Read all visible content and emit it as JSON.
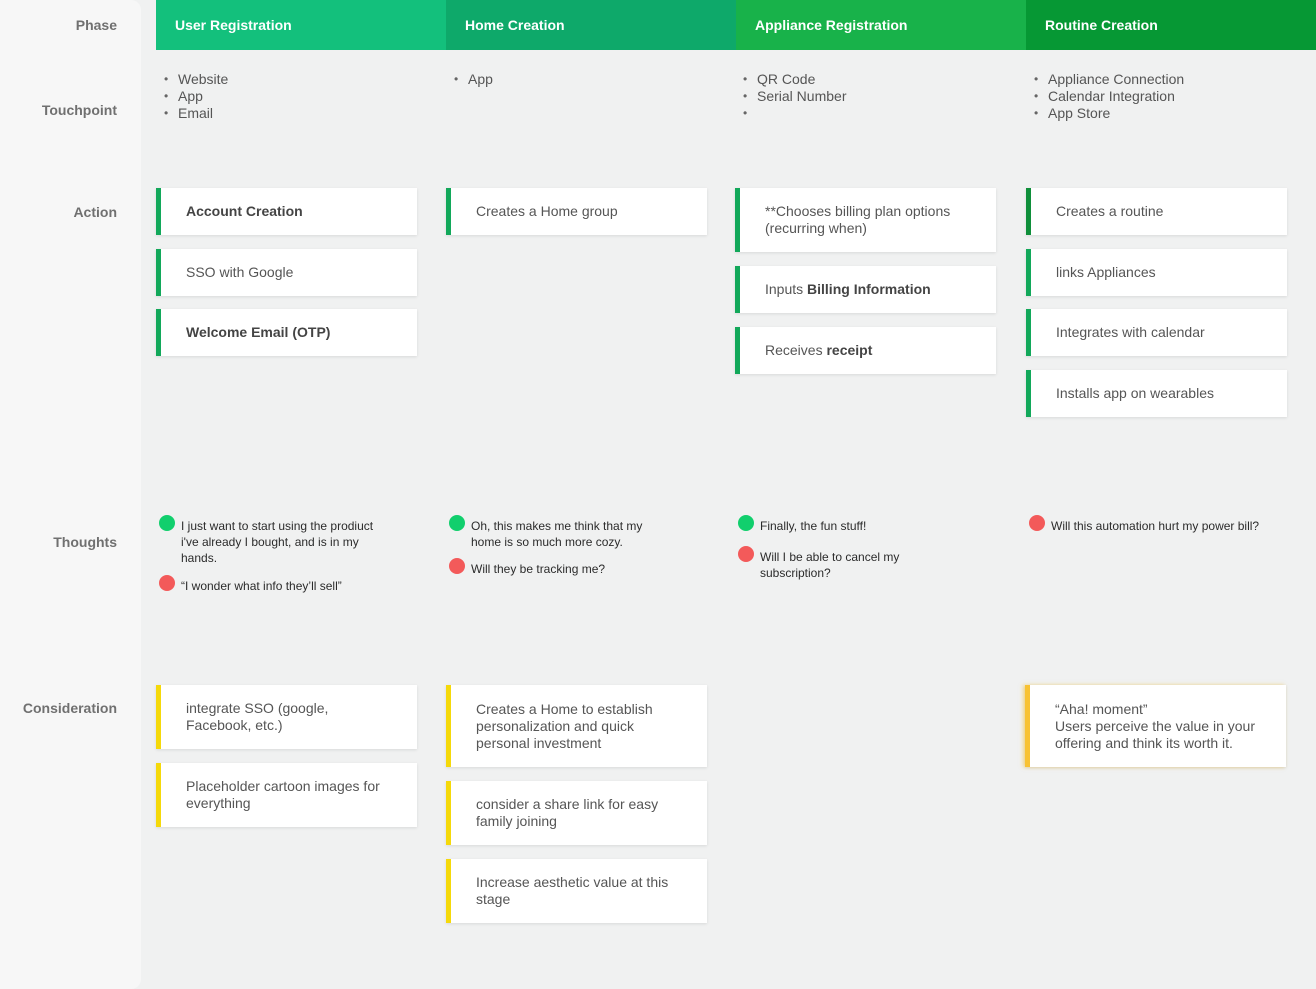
{
  "row_labels": {
    "phase": "Phase",
    "touchpoint": "Touchpoint",
    "action": "Action",
    "thoughts": "Thoughts",
    "consideration": "Consideration"
  },
  "colors": {
    "phase_1": "#13c07c",
    "phase_2": "#0ea96a",
    "phase_3": "#18b24a",
    "phase_4": "#069834",
    "positive": "#11cf6d",
    "negative": "#f35a5a",
    "action_accent": "#12a85a",
    "consideration_accent": "#f5d90a"
  },
  "phases": [
    {
      "name": "User Registration",
      "touchpoints": [
        "Website",
        "App",
        "Email"
      ],
      "actions": [
        {
          "text": "Account Creation"
        },
        {
          "text": "SSO with Google"
        },
        {
          "text": "Welcome Email (OTP)"
        }
      ],
      "thoughts": [
        {
          "sentiment": "positive",
          "text": "I just want to start using the prodiuct i've already I bought, and is in my hands."
        },
        {
          "sentiment": "negative",
          "text": "“I wonder what info they’ll sell”"
        }
      ],
      "considerations": [
        {
          "text": "integrate SSO (google, Facebook, etc.)"
        },
        {
          "text": "Placeholder cartoon images for everything"
        }
      ]
    },
    {
      "name": "Home Creation",
      "touchpoints": [
        "App"
      ],
      "actions": [
        {
          "text": "Creates a Home group"
        }
      ],
      "thoughts": [
        {
          "sentiment": "positive",
          "text": "Oh, this makes me think that my home is so much more cozy."
        },
        {
          "sentiment": "negative",
          "text": "Will they be tracking me?"
        }
      ],
      "considerations": [
        {
          "text": "Creates a Home to establish personalization and quick personal investment"
        },
        {
          "text": "consider a share link for easy family joining"
        },
        {
          "text": "Increase aesthetic value at this stage"
        }
      ]
    },
    {
      "name": "Appliance Registration",
      "touchpoints": [
        "QR Code",
        "Serial Number",
        ""
      ],
      "actions": [
        {
          "text": "**Chooses billing plan options (recurring when)"
        },
        {
          "text": "Inputs ",
          "bold": "Billing Information"
        },
        {
          "text": "Receives ",
          "bold": "receipt"
        }
      ],
      "thoughts": [
        {
          "sentiment": "positive",
          "text": "Finally, the fun stuff!"
        },
        {
          "sentiment": "negative",
          "text": "Will I be able to cancel my subscription?"
        }
      ],
      "considerations": []
    },
    {
      "name": "Routine Creation",
      "touchpoints": [
        "Appliance Connection",
        "Calendar Integration",
        "App Store"
      ],
      "actions": [
        {
          "text": "Creates a routine"
        },
        {
          "text": "links Appliances"
        },
        {
          "text": "Integrates with calendar"
        },
        {
          "text": "Installs app on wearables"
        }
      ],
      "thoughts": [
        {
          "sentiment": "negative",
          "text": "Will this automation hurt my power bill?"
        }
      ],
      "considerations": [
        {
          "title": "“Aha! moment”",
          "text": "Users perceive the value in your offering and think its worth it."
        }
      ]
    }
  ]
}
